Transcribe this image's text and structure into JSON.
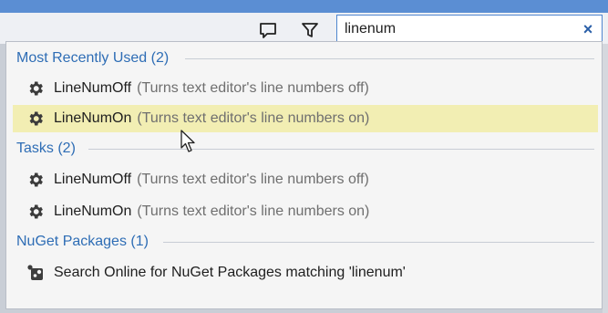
{
  "search": {
    "value": "linenum",
    "clear_label": "×"
  },
  "toolbar": {
    "icons": [
      "feedback-icon",
      "filter-icon"
    ]
  },
  "groups": [
    {
      "header": "Most Recently Used (2)",
      "items": [
        {
          "name": "LineNumOff",
          "desc": "(Turns text editor's line numbers off)",
          "icon": "gear-icon",
          "selected": false
        },
        {
          "name": "LineNumOn",
          "desc": "(Turns text editor's line numbers on)",
          "icon": "gear-icon",
          "selected": true
        }
      ]
    },
    {
      "header": "Tasks (2)",
      "items": [
        {
          "name": "LineNumOff",
          "desc": "(Turns text editor's line numbers off)",
          "icon": "gear-icon",
          "selected": false
        },
        {
          "name": "LineNumOn",
          "desc": "(Turns text editor's line numbers on)",
          "icon": "gear-icon",
          "selected": false
        }
      ]
    },
    {
      "header": "NuGet Packages (1)",
      "items": [
        {
          "name": "Search Online for NuGet Packages matching 'linenum'",
          "desc": "",
          "icon": "nuget-icon",
          "selected": false
        }
      ]
    }
  ],
  "colors": {
    "accent": "#2e6db5",
    "selected_row": "#f2eeb3",
    "title_bar": "#5b8ed3"
  }
}
